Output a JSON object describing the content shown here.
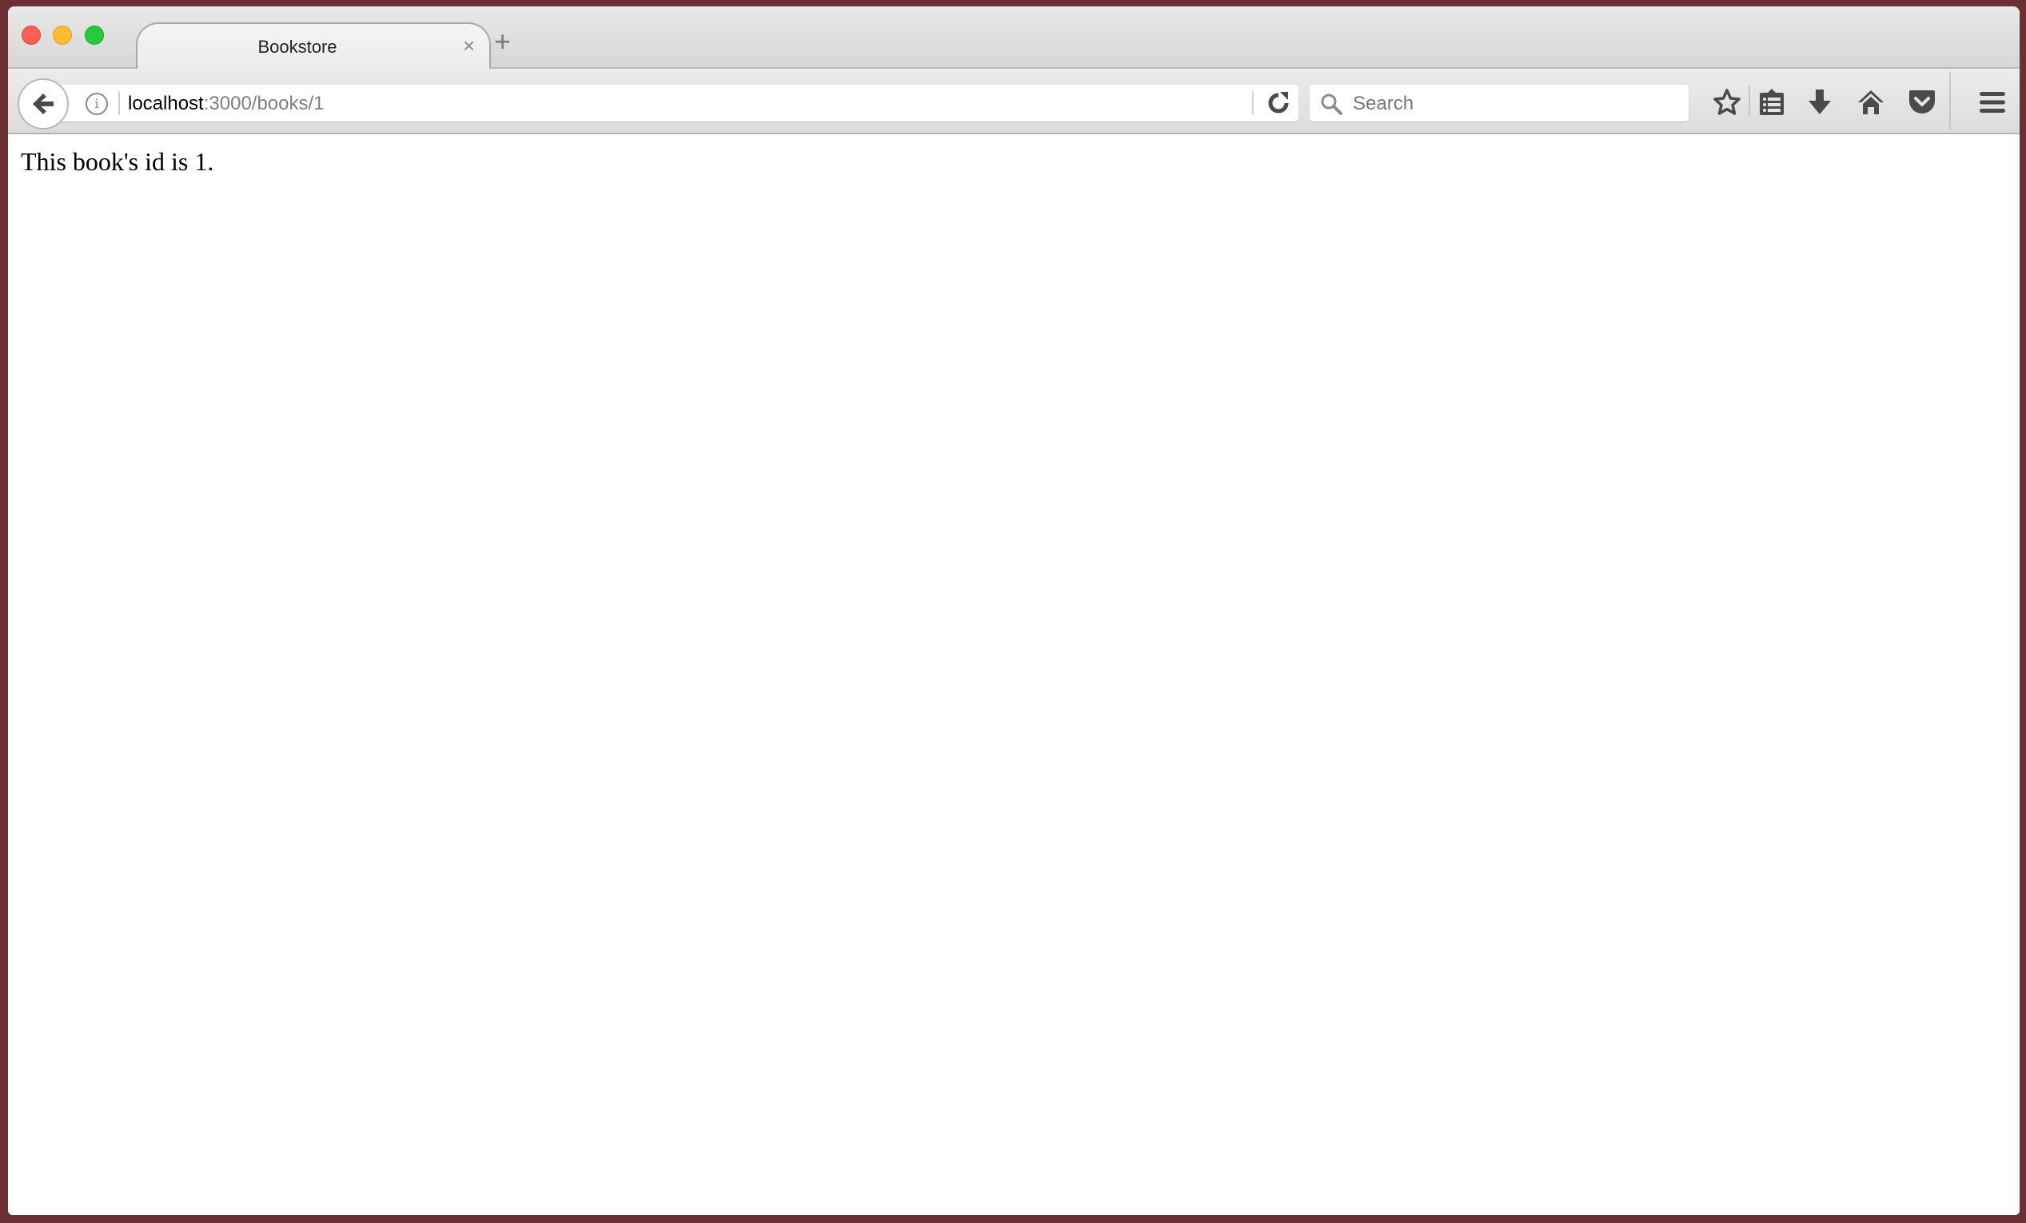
{
  "window": {
    "controls": [
      "close",
      "minimize",
      "maximize"
    ]
  },
  "tabs": [
    {
      "title": "Bookstore",
      "active": true,
      "close_glyph": "×"
    }
  ],
  "new_tab_glyph": "+",
  "navigation": {
    "url_host": "localhost",
    "url_rest": ":3000/books/1",
    "info_glyph": "i"
  },
  "search": {
    "placeholder": "Search"
  },
  "toolbar_icons": [
    "back-icon",
    "info-icon",
    "reload-icon",
    "search-icon",
    "bookmark-star-icon",
    "reading-list-icon",
    "download-icon",
    "home-icon",
    "pocket-icon",
    "menu-icon"
  ],
  "page": {
    "text": "This book's id is 1."
  },
  "colors": {
    "desktop": "#6b2f34",
    "icon": "#4a4a4a"
  }
}
